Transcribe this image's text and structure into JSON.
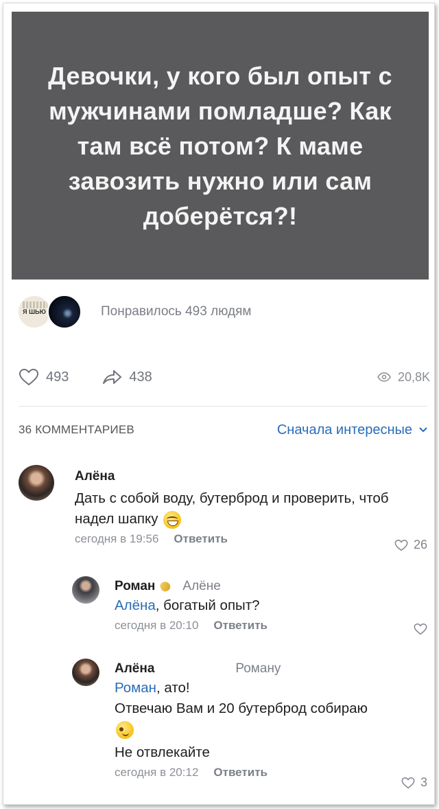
{
  "post": {
    "image_text": "Девочки, у кого был опыт с мужчинами помладше? Как там всё потом? К маме завозить нужно или сам доберётся?!"
  },
  "likes_summary": "Понравилось 493 людям",
  "liker_avatar_label": "Я ШЬЮ",
  "actions": {
    "likes": "493",
    "shares": "438",
    "views": "20,8K"
  },
  "comments_header": {
    "count_label": "36 КОММЕНТАРИЕВ",
    "sort_label": "Сначала интересные"
  },
  "comments": [
    {
      "author": "Алёна",
      "reply_to": "",
      "mention": "",
      "text": "Дать с собой воду, бутерброд и проверить, чтоб надел шапку",
      "emoji": "grin-emoji",
      "time": "сегодня в 19:56",
      "reply_label": "Ответить",
      "likes": "26"
    },
    {
      "author": "Роман",
      "reply_to": "Алёне",
      "mention": "Алёна",
      "text": ", богатый опыт?",
      "time": "сегодня в 20:10",
      "reply_label": "Ответить",
      "likes": ""
    },
    {
      "author": "Алёна",
      "reply_to": "Роману",
      "mention": "Роман",
      "text": ", ато!",
      "text2": "Отвечаю Вам и 20 бутерброд собираю",
      "emoji": "wink-emoji",
      "text3": "Не отвлекайте",
      "time": "сегодня в 20:12",
      "reply_label": "Ответить",
      "likes": "3"
    }
  ],
  "colors": {
    "image_bg": "#5a5a5c",
    "accent_link": "#2a6cb8",
    "muted": "#7c8088"
  }
}
